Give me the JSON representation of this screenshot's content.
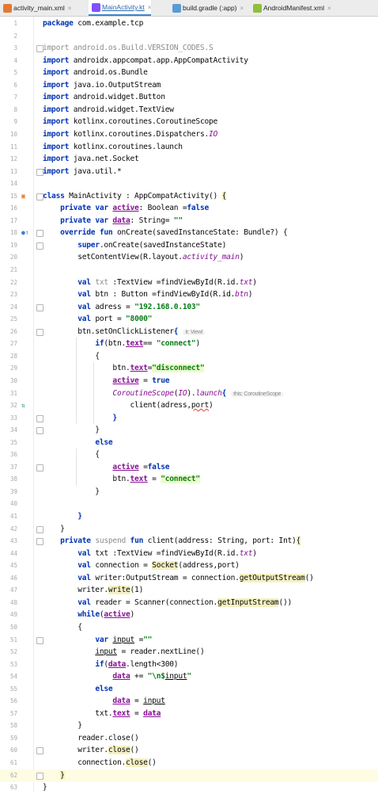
{
  "tabs": [
    {
      "label": "activity_main.xml",
      "close": "×",
      "icon": "#e37933"
    },
    {
      "label": "MainActivity.kt",
      "close": "×",
      "icon": "#7f52ff"
    },
    {
      "label": "build.gradle (:app)",
      "close": "×",
      "icon": "#5a9bd4"
    },
    {
      "label": "AndroidManifest.xml",
      "close": "×",
      "icon": "#8fbf3c"
    }
  ],
  "hints": {
    "view": "it: View!",
    "scope": "this: CoroutineScope"
  },
  "line_numbers": [
    "1",
    "2",
    "3",
    "4",
    "5",
    "6",
    "7",
    "8",
    "9",
    "10",
    "11",
    "12",
    "13",
    "14",
    "15",
    "16",
    "17",
    "18",
    "19",
    "20",
    "21",
    "22",
    "23",
    "24",
    "25",
    "26",
    "27",
    "28",
    "29",
    "30",
    "31",
    "32",
    "33",
    "34",
    "35",
    "36",
    "37",
    "38",
    "39",
    "40",
    "41",
    "42",
    "43",
    "44",
    "45",
    "46",
    "47",
    "48",
    "49",
    "50",
    "51",
    "52",
    "53",
    "54",
    "55",
    "56",
    "57",
    "58",
    "59",
    "60",
    "61",
    "62",
    "63"
  ],
  "lines": [
    [
      [
        "kw",
        "package "
      ],
      [
        "",
        "com.example.tcp"
      ]
    ],
    [],
    [
      [
        "gray",
        "import android.os.Build.VERSION_CODES.S"
      ]
    ],
    [
      [
        "kw",
        "import "
      ],
      [
        "",
        "androidx.appcompat.app.AppCompatActivity"
      ]
    ],
    [
      [
        "kw",
        "import "
      ],
      [
        "",
        "android.os.Bundle"
      ]
    ],
    [
      [
        "kw",
        "import "
      ],
      [
        "",
        "java.io.OutputStream"
      ]
    ],
    [
      [
        "kw",
        "import "
      ],
      [
        "",
        "android.widget.Button"
      ]
    ],
    [
      [
        "kw",
        "import "
      ],
      [
        "",
        "android.widget.TextView"
      ]
    ],
    [
      [
        "kw",
        "import "
      ],
      [
        "",
        "kotlinx.coroutines.CoroutineScope"
      ]
    ],
    [
      [
        "kw",
        "import "
      ],
      [
        "",
        "kotlinx.coroutines.Dispatchers."
      ],
      [
        "it",
        "IO"
      ]
    ],
    [
      [
        "kw",
        "import "
      ],
      [
        "",
        "kotlinx.coroutines.launch"
      ]
    ],
    [
      [
        "kw",
        "import "
      ],
      [
        "",
        "java.net.Socket"
      ]
    ],
    [
      [
        "kw",
        "import "
      ],
      [
        "",
        "java.util.*"
      ]
    ],
    [],
    [
      [
        "kw",
        "class "
      ],
      [
        "",
        "MainActivity : AppCompatActivity() "
      ],
      [
        "yhl",
        "{"
      ]
    ],
    [
      [
        "",
        "    "
      ],
      [
        "kw",
        "private var "
      ],
      [
        "propu",
        "active"
      ],
      [
        "",
        ": Boolean ="
      ],
      [
        "kw",
        "false"
      ]
    ],
    [
      [
        "",
        "    "
      ],
      [
        "kw",
        "private var "
      ],
      [
        "propu",
        "data"
      ],
      [
        "",
        ": String= "
      ],
      [
        "str",
        "\"\""
      ]
    ],
    [
      [
        "",
        "    "
      ],
      [
        "kw",
        "override fun "
      ],
      [
        "",
        "onCreate(savedInstanceState: Bundle?) {"
      ]
    ],
    [
      [
        "",
        "        "
      ],
      [
        "kw",
        "super"
      ],
      [
        "",
        ".onCreate(savedInstanceState)"
      ]
    ],
    [
      [
        "",
        "        setContentView(R.layout."
      ],
      [
        "it",
        "activity_main"
      ],
      [
        "",
        ")"
      ]
    ],
    [],
    [
      [
        "",
        "        "
      ],
      [
        "kw",
        "val "
      ],
      [
        "gray",
        "txt"
      ],
      [
        "",
        " :TextView =findViewById(R.id."
      ],
      [
        "it",
        "txt"
      ],
      [
        "",
        ")"
      ]
    ],
    [
      [
        "",
        "        "
      ],
      [
        "kw",
        "val "
      ],
      [
        "",
        "btn : Button =findViewById(R.id."
      ],
      [
        "it",
        "btn"
      ],
      [
        "",
        ")"
      ]
    ],
    [
      [
        "",
        "        "
      ],
      [
        "kw",
        "val "
      ],
      [
        "",
        "adress = "
      ],
      [
        "str",
        "\"192.168.0.103\""
      ]
    ],
    [
      [
        "",
        "        "
      ],
      [
        "kw",
        "val "
      ],
      [
        "",
        "port = "
      ],
      [
        "str",
        "\"8000\""
      ]
    ],
    [
      [
        "",
        "        btn.setOnClickListener"
      ],
      [
        "kw",
        "{"
      ],
      [
        "hint",
        "$hints.view"
      ]
    ],
    [
      [
        "",
        "            "
      ],
      [
        "kw",
        "if"
      ],
      [
        "",
        "(btn."
      ],
      [
        "propu",
        "text"
      ],
      [
        "",
        "== "
      ],
      [
        "str",
        "\"connect\""
      ],
      [
        "",
        ")"
      ]
    ],
    [
      [
        "",
        "            {"
      ]
    ],
    [
      [
        "",
        "                btn."
      ],
      [
        "propu",
        "text"
      ],
      [
        "",
        "="
      ],
      [
        "strhl",
        "\"disconnect\""
      ]
    ],
    [
      [
        "",
        "                "
      ],
      [
        "propu",
        "active"
      ],
      [
        "",
        " = "
      ],
      [
        "kw",
        "true"
      ]
    ],
    [
      [
        "",
        "                "
      ],
      [
        "it",
        "CoroutineScope"
      ],
      [
        "",
        "("
      ],
      [
        "it",
        "IO"
      ],
      [
        "",
        ")."
      ],
      [
        "it",
        "launch"
      ],
      [
        "kw",
        "{"
      ],
      [
        "hint",
        "$hints.scope"
      ]
    ],
    [
      [
        "",
        "                    client(adress,"
      ],
      [
        "squig",
        "port"
      ],
      [
        "",
        ")"
      ]
    ],
    [
      [
        "",
        "                "
      ],
      [
        "kw",
        "}"
      ]
    ],
    [
      [
        "",
        "            }"
      ]
    ],
    [
      [
        "",
        "            "
      ],
      [
        "kw",
        "else"
      ]
    ],
    [
      [
        "",
        "            {"
      ]
    ],
    [
      [
        "",
        "                "
      ],
      [
        "propu",
        "active"
      ],
      [
        "",
        " ="
      ],
      [
        "kw",
        "false"
      ]
    ],
    [
      [
        "",
        "                btn."
      ],
      [
        "propu",
        "text"
      ],
      [
        "",
        " = "
      ],
      [
        "strhl",
        "\"connect\""
      ]
    ],
    [
      [
        "",
        "            }"
      ]
    ],
    [],
    [
      [
        "",
        "        "
      ],
      [
        "kw",
        "}"
      ]
    ],
    [
      [
        "",
        "    }"
      ]
    ],
    [
      [
        "",
        "    "
      ],
      [
        "kw",
        "private "
      ],
      [
        "gray",
        "suspend "
      ],
      [
        "kw",
        "fun "
      ],
      [
        "",
        "client(address: String, port: Int)"
      ],
      [
        "yhl",
        "{"
      ]
    ],
    [
      [
        "",
        "        "
      ],
      [
        "kw",
        "val "
      ],
      [
        "",
        ""
      ],
      [
        "",
        "txt :TextView =findViewById(R.id."
      ],
      [
        "it",
        "txt"
      ],
      [
        "",
        ")"
      ]
    ],
    [
      [
        "",
        "        "
      ],
      [
        "kw",
        "val "
      ],
      [
        "",
        "connection = "
      ],
      [
        "yhl",
        "Socket"
      ],
      [
        "",
        "(address,port)"
      ]
    ],
    [
      [
        "",
        "        "
      ],
      [
        "kw",
        "val "
      ],
      [
        "",
        "writer:OutputStream = connection."
      ],
      [
        "yhl",
        "getOutputStream"
      ],
      [
        "",
        "()"
      ]
    ],
    [
      [
        "",
        "        writer."
      ],
      [
        "yhl",
        "write"
      ],
      [
        "",
        "(1)"
      ]
    ],
    [
      [
        "",
        "        "
      ],
      [
        "kw",
        "val "
      ],
      [
        "",
        "reader = Scanner(connection."
      ],
      [
        "yhl",
        "getInputStream"
      ],
      [
        "",
        "())"
      ]
    ],
    [
      [
        "",
        "        "
      ],
      [
        "kw",
        "while"
      ],
      [
        "",
        "("
      ],
      [
        "propu",
        "active"
      ],
      [
        "",
        ")"
      ]
    ],
    [
      [
        "",
        "        {"
      ]
    ],
    [
      [
        "",
        "            "
      ],
      [
        "kw",
        "var "
      ],
      [
        "ul",
        "input"
      ],
      [
        "",
        " ="
      ],
      [
        "str",
        "\"\""
      ]
    ],
    [
      [
        "",
        "            "
      ],
      [
        "ul",
        "input"
      ],
      [
        "",
        " = reader.nextLine()"
      ]
    ],
    [
      [
        "",
        "            "
      ],
      [
        "kw",
        "if"
      ],
      [
        "",
        "("
      ],
      [
        "propu",
        "data"
      ],
      [
        "",
        ".length<300)"
      ]
    ],
    [
      [
        "",
        "                "
      ],
      [
        "propu",
        "data"
      ],
      [
        "",
        " += "
      ],
      [
        "str",
        "\"\\n$"
      ],
      [
        "ul",
        "input"
      ],
      [
        "str",
        "\""
      ]
    ],
    [
      [
        "",
        "            "
      ],
      [
        "kw",
        "else"
      ]
    ],
    [
      [
        "",
        "                "
      ],
      [
        "propu",
        "data"
      ],
      [
        "",
        " = "
      ],
      [
        "ul",
        "input"
      ]
    ],
    [
      [
        "",
        "            txt."
      ],
      [
        "propu",
        "text"
      ],
      [
        "",
        " = "
      ],
      [
        "propu",
        "data"
      ]
    ],
    [
      [
        "",
        "        }"
      ]
    ],
    [
      [
        "",
        "        reader.close()"
      ]
    ],
    [
      [
        "",
        "        writer."
      ],
      [
        "yhl",
        "close"
      ],
      [
        "",
        "()"
      ]
    ],
    [
      [
        "",
        "        connection."
      ],
      [
        "yhl",
        "close"
      ],
      [
        "",
        "()"
      ]
    ],
    [
      [
        "",
        "    "
      ],
      [
        "yhl",
        "}"
      ]
    ],
    [
      [
        "",
        "}"
      ]
    ]
  ]
}
